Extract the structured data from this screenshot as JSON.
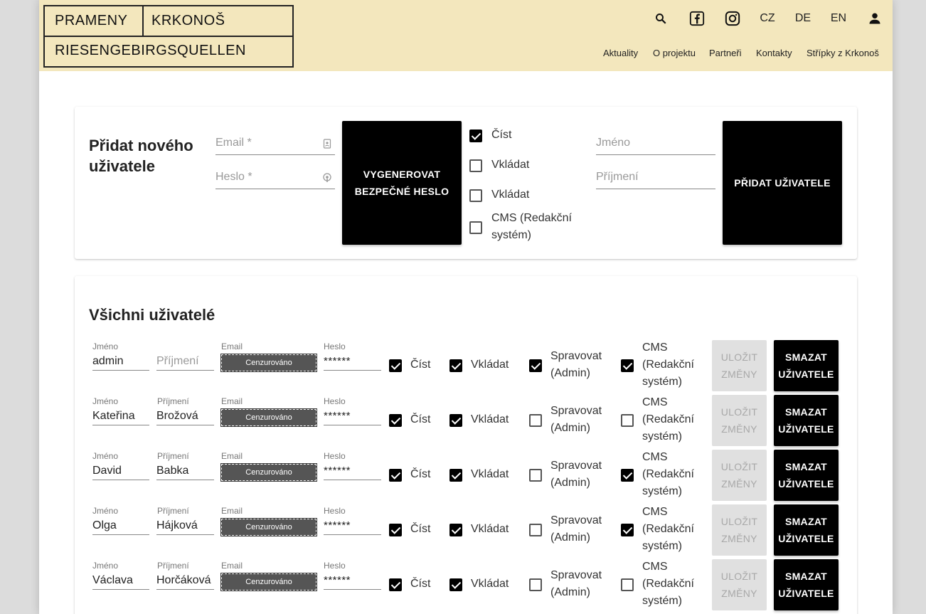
{
  "header": {
    "logo": {
      "line1_left": "PRAMENY",
      "line1_right": "KRKONOŠ",
      "line2": "RIESENGEBIRGSQUELLEN"
    },
    "languages": [
      "CZ",
      "DE",
      "EN"
    ],
    "nav": [
      "Aktuality",
      "O projektu",
      "Partneři",
      "Kontakty",
      "Střípky z Krkonoš"
    ]
  },
  "add_user": {
    "title": "Přidat nového uživatele",
    "email_placeholder": "Email *",
    "password_placeholder": "Heslo *",
    "generate_button": "VYGENEROVAT BEZPEČNÉ HESLO",
    "permissions": [
      {
        "label": "Číst",
        "checked": true
      },
      {
        "label": "Vkládat",
        "checked": false
      },
      {
        "label": "Vkládat",
        "checked": false
      },
      {
        "label": "CMS (Redakční systém)",
        "checked": false
      }
    ],
    "first_name_placeholder": "Jméno",
    "last_name_placeholder": "Příjmení",
    "add_button": "PŘIDAT UŽIVATELE"
  },
  "all_users": {
    "title": "Všichni uživatelé",
    "labels": {
      "first_name": "Jméno",
      "last_name": "Příjmení",
      "email": "Email",
      "password": "Heslo"
    },
    "censored_text": "Cenzurováno",
    "password_mask": "******",
    "perm_labels": {
      "read": "Číst",
      "insert": "Vkládat",
      "admin": "Spravovat (Admin)",
      "cms": "CMS (Redakční systém)"
    },
    "save_button": "ULOŽIT ZMĚNY",
    "delete_button": "SMAZAT UŽIVATELE",
    "users": [
      {
        "first_name": "admin",
        "last_name": "",
        "last_name_placeholder": "Příjmení",
        "read": true,
        "insert": true,
        "admin": true,
        "cms": true
      },
      {
        "first_name": "Kateřina",
        "last_name": "Brožová",
        "read": true,
        "insert": true,
        "admin": false,
        "cms": false
      },
      {
        "first_name": "David",
        "last_name": "Babka",
        "read": true,
        "insert": true,
        "admin": false,
        "cms": true
      },
      {
        "first_name": "Olga",
        "last_name": "Hájková",
        "read": true,
        "insert": true,
        "admin": false,
        "cms": true
      },
      {
        "first_name": "Václava",
        "last_name": "Horčáková",
        "read": true,
        "insert": true,
        "admin": false,
        "cms": false
      }
    ]
  }
}
